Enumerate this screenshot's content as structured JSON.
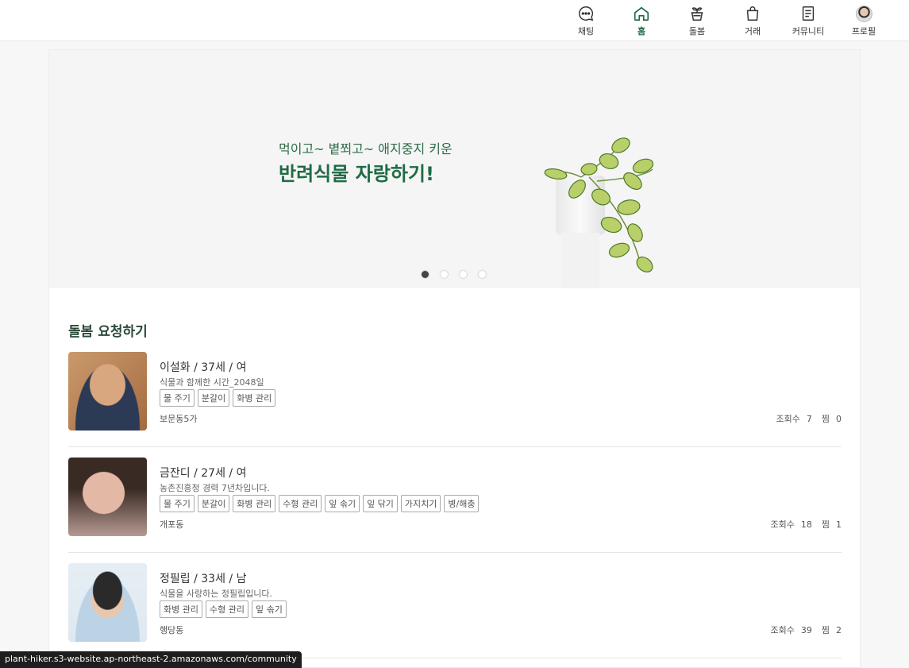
{
  "nav": [
    {
      "label": "채팅",
      "icon": "chat-icon"
    },
    {
      "label": "홈",
      "icon": "home-icon",
      "active": true
    },
    {
      "label": "돌봄",
      "icon": "plant-pot-icon"
    },
    {
      "label": "거래",
      "icon": "shopping-bag-icon"
    },
    {
      "label": "커뮤니티",
      "icon": "document-icon"
    },
    {
      "label": "프로필",
      "icon": "avatar"
    }
  ],
  "banner": {
    "subtitle": "먹이고~ 볕쬐고~ 애지중지 키운",
    "title": "반려식물 자랑하기!",
    "slide_count": 4,
    "active_slide": 1
  },
  "section": {
    "title": "돌봄 요청하기"
  },
  "requests": [
    {
      "name": "이설화 / 37세 / 여",
      "intro": "식물과 함께한 시간_2048일",
      "tags": [
        "물 주기",
        "분갈이",
        "화병 관리"
      ],
      "location": "보문동5가",
      "views_label": "조회수",
      "views": "7",
      "likes_label": "찜",
      "likes": "0"
    },
    {
      "name": "금잔디 / 27세 / 여",
      "intro": "농촌진흥청 경력 7년차입니다.",
      "tags": [
        "물 주기",
        "분갈이",
        "화병 관리",
        "수형 관리",
        "잎 솎기",
        "잎 닦기",
        "가지치기",
        "병/해충"
      ],
      "location": "개포동",
      "views_label": "조회수",
      "views": "18",
      "likes_label": "찜",
      "likes": "1"
    },
    {
      "name": "정필립 / 33세 / 남",
      "intro": "식물을 사랑하는 정필립입니다.",
      "tags": [
        "화병 관리",
        "수형 관리",
        "잎 솎기"
      ],
      "location": "행당동",
      "views_label": "조회수",
      "views": "39",
      "likes_label": "찜",
      "likes": "2"
    }
  ],
  "status_url": "plant-hiker.s3-website.ap-northeast-2.amazonaws.com/community",
  "colors": {
    "accent": "#1f6b45",
    "banner_bg": "#f5f5f5"
  }
}
